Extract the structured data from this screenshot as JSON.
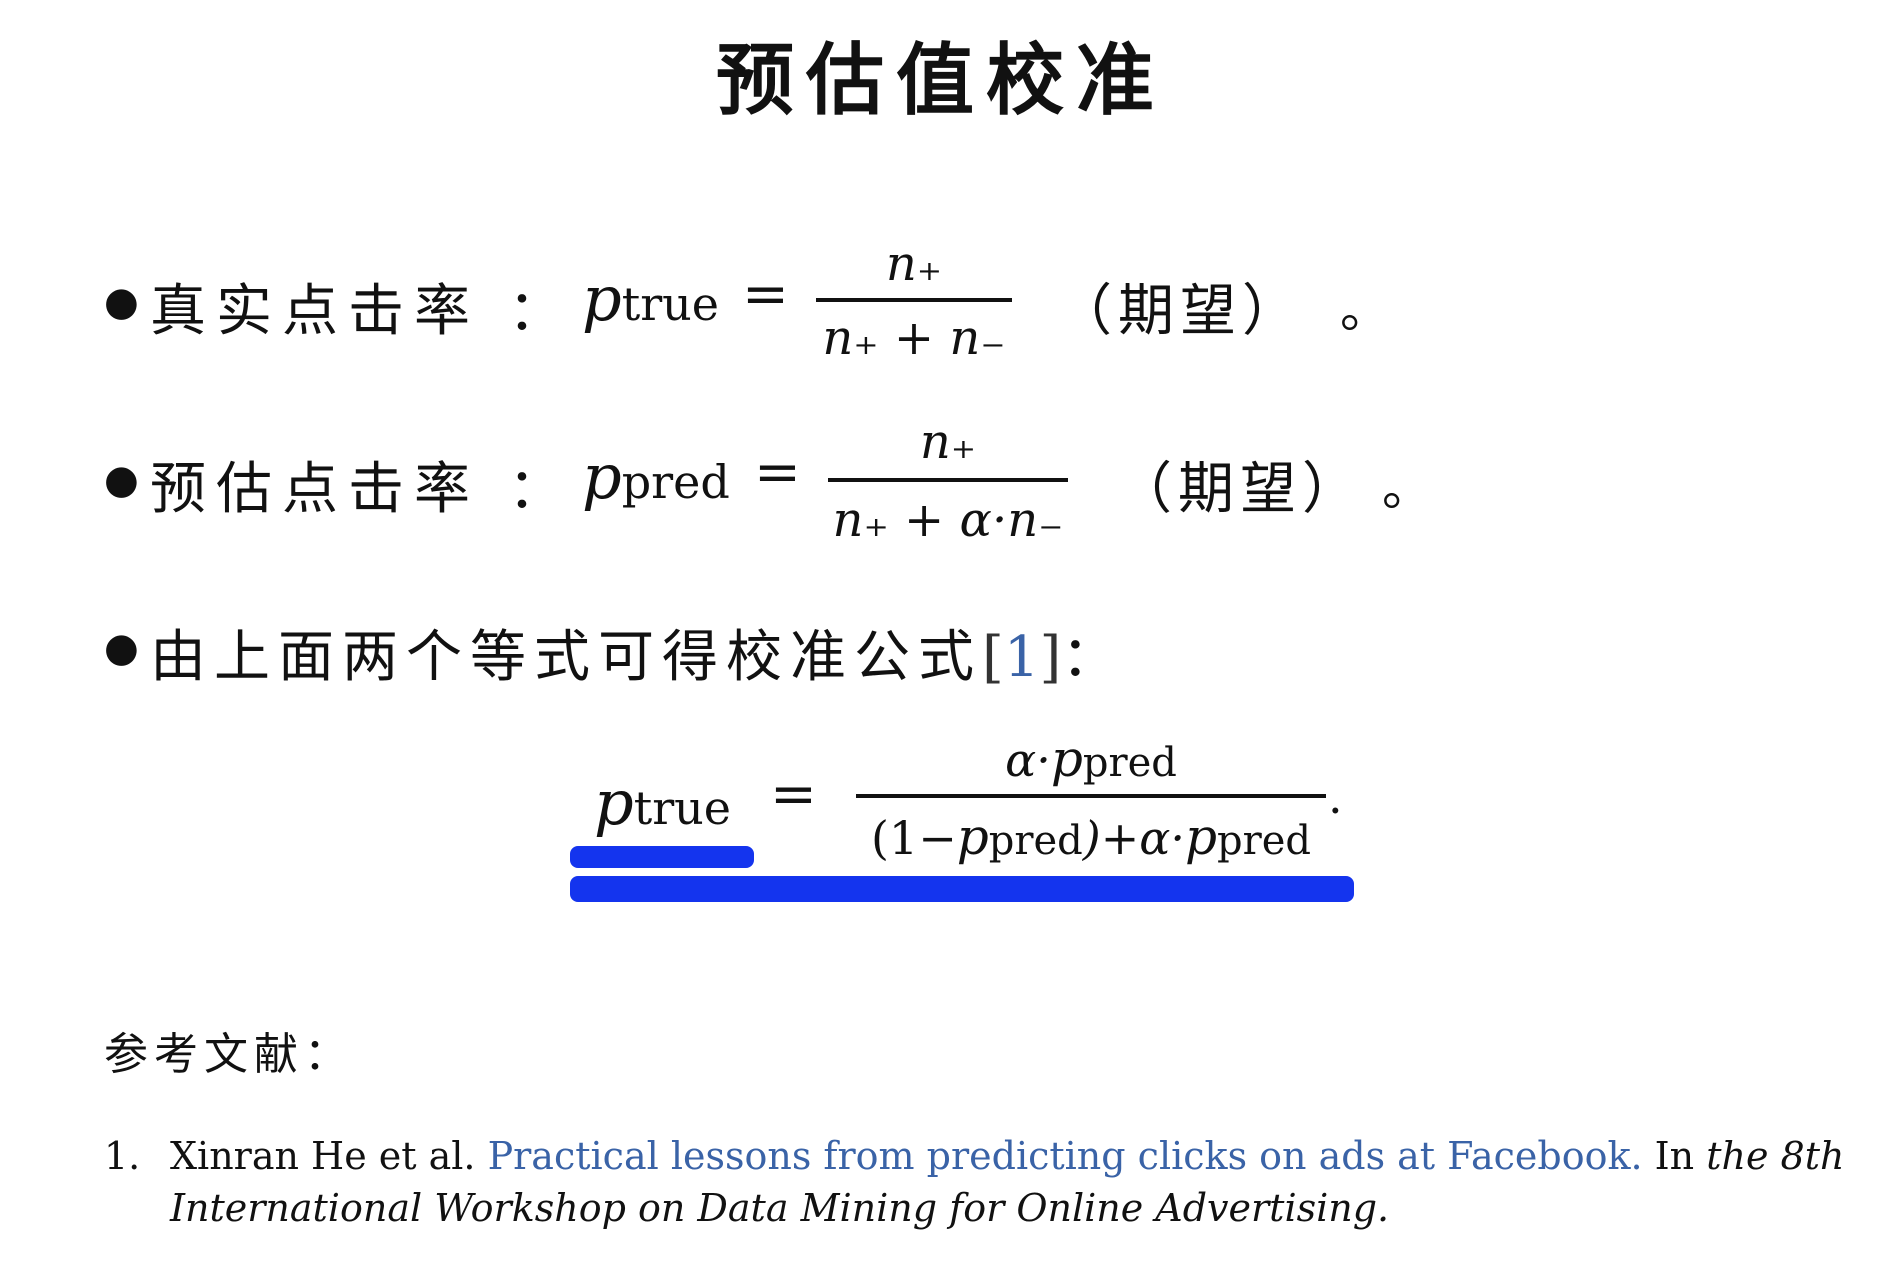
{
  "title": "预估值校准",
  "bullets": [
    {
      "label": "真实点击率",
      "colon": "：",
      "lhs_symbol": "p",
      "lhs_sub": "true",
      "eq": "=",
      "numerator": "n₊",
      "denominator": "n₊ + n₋",
      "note": "（期望）",
      "end": "。"
    },
    {
      "label": "预估点击率",
      "colon": "：",
      "lhs_symbol": "p",
      "lhs_sub": "pred",
      "eq": "=",
      "numerator": "n₊",
      "denominator": "n₊ + α·n₋",
      "note": "（期望）",
      "end": "。"
    },
    {
      "text": "由上面两个等式可得校准公式",
      "ref_open": "[",
      "ref_num": "1",
      "ref_close": "]",
      "colon": "："
    }
  ],
  "formula": {
    "lhs_symbol": "p",
    "lhs_sub": "true",
    "eq": "=",
    "num_alpha": "α·",
    "num_p": "p",
    "num_sub": "pred",
    "den_open": "(1−",
    "den_p1": "p",
    "den_sub1": "pred",
    "den_close": ")+α·",
    "den_p2": "p",
    "den_sub2": "pred",
    "end": "."
  },
  "highlight_color": "#1434ee",
  "link_color": "#3a63a7",
  "references": {
    "heading": "参考文献：",
    "items": [
      {
        "index": "1.",
        "authors": "Xinran He et al.",
        "title": "Practical lessons from predicting clicks on ads at Facebook.",
        "in": "In",
        "venue_line1": "the 8th",
        "venue_line2": "International Workshop on Data Mining for Online Advertising."
      }
    ]
  }
}
